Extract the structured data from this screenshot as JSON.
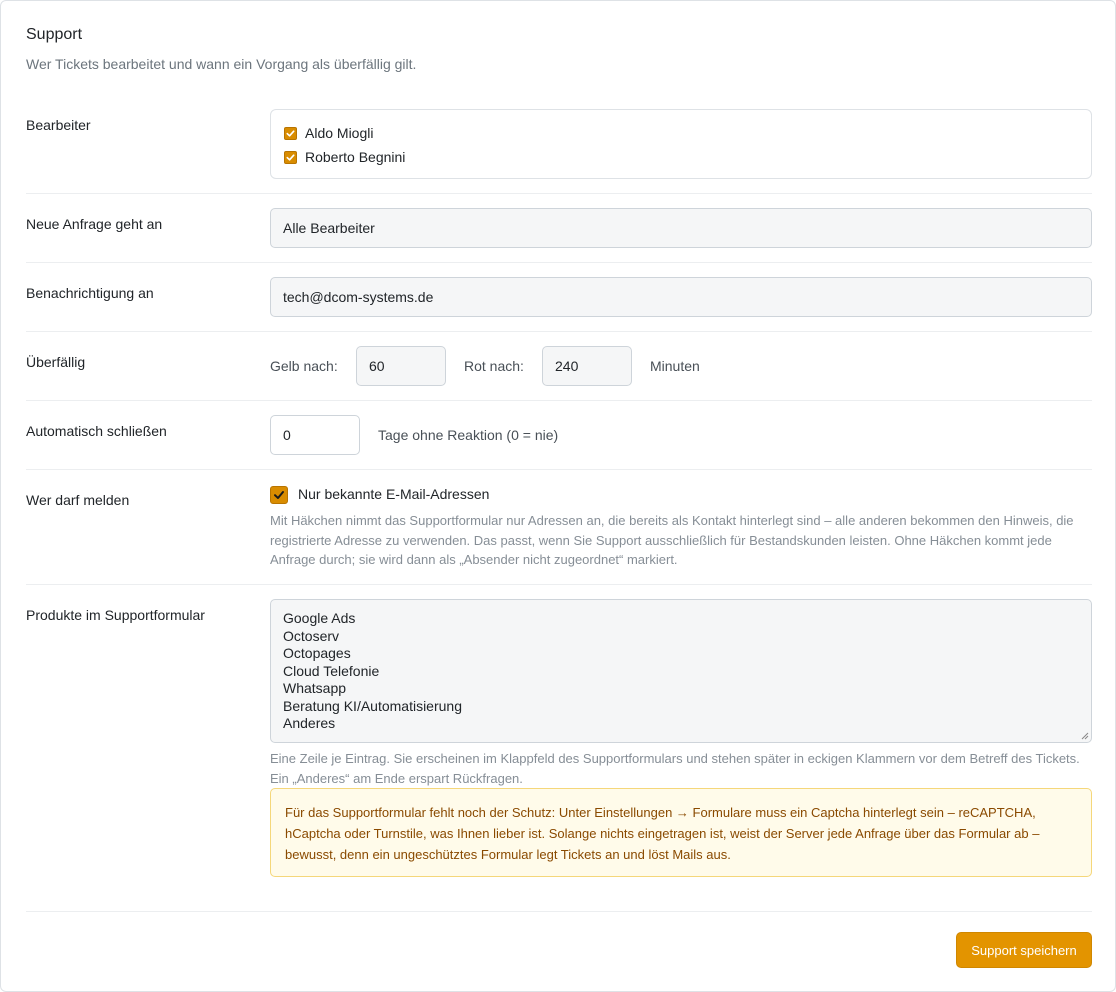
{
  "header": {
    "title": "Support",
    "subtitle": "Wer Tickets bearbeitet und wann ein Vorgang als überfällig gilt."
  },
  "bearbeiter": {
    "label": "Bearbeiter",
    "items": [
      {
        "name": "Aldo Miogli",
        "checked": true
      },
      {
        "name": "Roberto Begnini",
        "checked": true
      }
    ]
  },
  "neue_anfrage": {
    "label": "Neue Anfrage geht an",
    "value": "Alle Bearbeiter"
  },
  "benachrichtigung": {
    "label": "Benachrichtigung an",
    "value": "tech@dcom-systems.de"
  },
  "ueberfaellig": {
    "label": "Überfällig",
    "yellow_label": "Gelb nach:",
    "yellow_value": "60",
    "red_label": "Rot nach:",
    "red_value": "240",
    "unit": "Minuten"
  },
  "auto_close": {
    "label": "Automatisch schließen",
    "value": "0",
    "suffix": "Tage ohne Reaktion (0 = nie)"
  },
  "wer_darf_melden": {
    "label": "Wer darf melden",
    "checkbox_label": "Nur bekannte E-Mail-Adressen",
    "checked": true,
    "help": "Mit Häkchen nimmt das Supportformular nur Adressen an, die bereits als Kontakt hinterlegt sind – alle anderen bekommen den Hinweis, die registrierte Adresse zu verwenden. Das passt, wenn Sie Support ausschließlich für Bestandskunden leisten. Ohne Häkchen kommt jede Anfrage durch; sie wird dann als „Absender nicht zugeordnet“ markiert."
  },
  "produkte": {
    "label": "Produkte im Supportformular",
    "lines": [
      "Google Ads",
      "Octoserv",
      "Octopages",
      "Cloud Telefonie",
      "Whatsapp",
      "Beratung KI/Automatisierung",
      "Anderes"
    ],
    "help": "Eine Zeile je Eintrag. Sie erscheinen im Klappfeld des Supportformulars und stehen später in eckigen Klammern vor dem Betreff des Tickets. Ein „Anderes“ am Ende erspart Rückfragen.",
    "warning": "Für das Supportformular fehlt noch der Schutz: Unter Einstellungen → Formulare muss ein Captcha hinterlegt sein – reCAPTCHA, hCaptcha oder Turnstile, was Ihnen lieber ist. Solange nichts eingetragen ist, weist der Server jede Anfrage über das Formular ab – bewusst, denn ein ungeschütztes Formular legt Tickets an und löst Mails aus."
  },
  "footer": {
    "save_label": "Support speichern"
  },
  "colors": {
    "accent": "#e39400",
    "warning_bg": "#fffbea",
    "warning_text": "#8a4a00"
  }
}
